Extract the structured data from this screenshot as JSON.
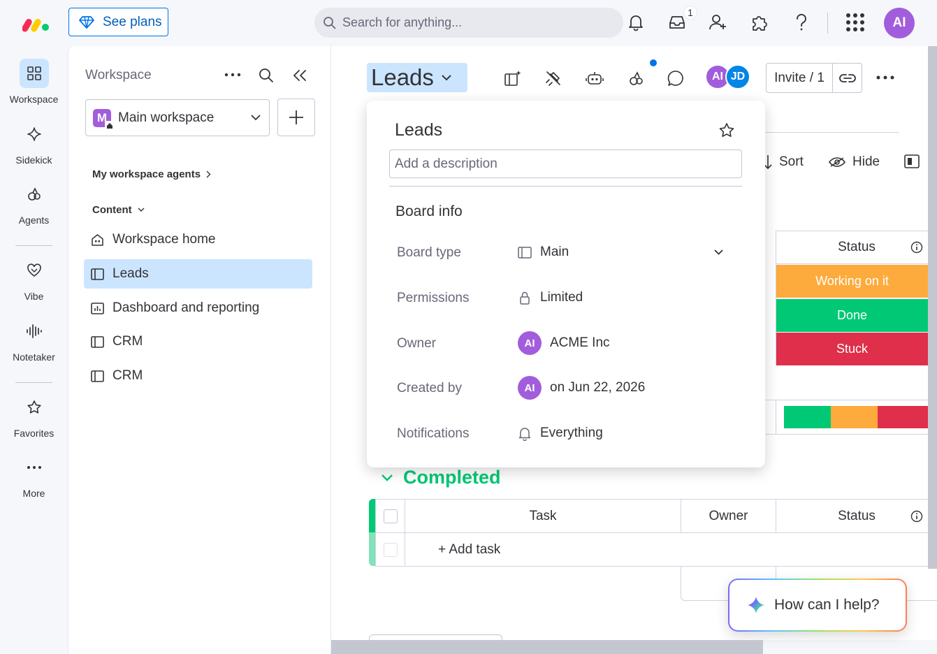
{
  "topbar": {
    "see_plans": "See plans",
    "search_placeholder": "Search for anything...",
    "inbox_badge": "1",
    "user_initials": "AI"
  },
  "rail": [
    {
      "label": "Workspace"
    },
    {
      "label": "Sidekick"
    },
    {
      "label": "Agents"
    },
    {
      "label": "Vibe"
    },
    {
      "label": "Notetaker"
    },
    {
      "label": "Favorites"
    },
    {
      "label": "More"
    }
  ],
  "workspace": {
    "title": "Workspace",
    "selected": "Main workspace",
    "selected_initial": "M",
    "agents_link": "My workspace agents",
    "content_label": "Content",
    "items": [
      {
        "label": "Workspace home"
      },
      {
        "label": "Leads"
      },
      {
        "label": "Dashboard and reporting"
      },
      {
        "label": "CRM"
      },
      {
        "label": "CRM"
      }
    ]
  },
  "board": {
    "title": "Leads",
    "avatars": [
      "AI",
      "JD"
    ],
    "invite": "Invite / 1",
    "toolbar": {
      "sort": "Sort",
      "hide": "Hide"
    }
  },
  "table_top": {
    "status_header": "Status",
    "statuses": [
      {
        "label": "Working on it",
        "color": "#fdab3d"
      },
      {
        "label": "Done",
        "color": "#00c875"
      },
      {
        "label": "Stuck",
        "color": "#df2f4a"
      }
    ]
  },
  "completed_group": {
    "title": "Completed",
    "columns": {
      "task": "Task",
      "owner": "Owner",
      "status": "Status"
    },
    "add_task": "+ Add task"
  },
  "popover": {
    "title": "Leads",
    "description_placeholder": "Add a description",
    "section": "Board info",
    "rows": [
      {
        "label": "Board type",
        "value": "Main"
      },
      {
        "label": "Permissions",
        "value": "Limited"
      },
      {
        "label": "Owner",
        "value": "ACME Inc",
        "avatar": "AI"
      },
      {
        "label": "Created by",
        "value": "on Jun 22, 2026",
        "avatar": "AI"
      },
      {
        "label": "Notifications",
        "value": "Everything"
      }
    ]
  },
  "help": {
    "text": "How can I help?"
  },
  "colors": {
    "accent": "#0073ea",
    "selected": "#cce5ff",
    "avatar_purple": "#a25ddc",
    "avatar_blue": "#0086e6",
    "group_green": "#00c875"
  }
}
